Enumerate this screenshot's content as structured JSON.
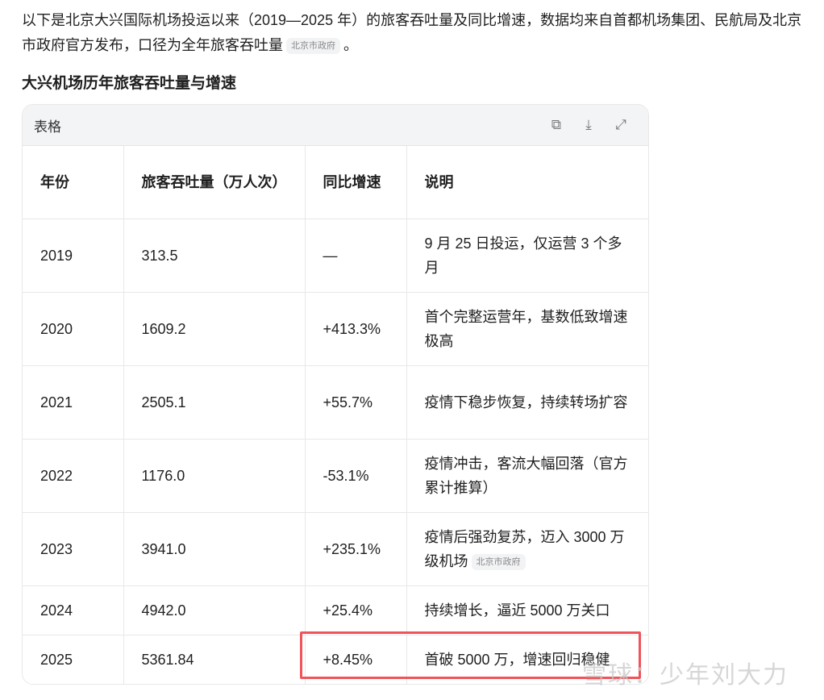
{
  "intro": {
    "text": "以下是北京大兴国际机场投运以来（2019—2025 年）的旅客吞吐量及同比增速，数据均来自首都机场集团、民航局及北京市政府官方发布，口径为全年旅客吞吐量",
    "source_badge": "北京市政府",
    "end": "。"
  },
  "heading": "大兴机场历年旅客吞吐量与增速",
  "table_card": {
    "title": "表格",
    "icons": [
      "copy-icon",
      "download-icon",
      "expand-icon"
    ]
  },
  "table": {
    "headers": [
      "年份",
      "旅客吞吐量（万人次）",
      "同比增速",
      "说明"
    ],
    "rows": [
      {
        "year": "2019",
        "volume": "313.5",
        "growth": "—",
        "note": "9 月 25 日投运，仅运营 3 个多月"
      },
      {
        "year": "2020",
        "volume": "1609.2",
        "growth": "+413.3%",
        "note": "首个完整运营年，基数低致增速极高"
      },
      {
        "year": "2021",
        "volume": "2505.1",
        "growth": "+55.7%",
        "note": "疫情下稳步恢复，持续转场扩容"
      },
      {
        "year": "2022",
        "volume": "1176.0",
        "growth": "-53.1%",
        "note": "疫情冲击，客流大幅回落（官方累计推算）"
      },
      {
        "year": "2023",
        "volume": "3941.0",
        "growth": "+235.1%",
        "note": "疫情后强劲复苏，迈入 3000 万级机场",
        "badge": "北京市政府"
      },
      {
        "year": "2024",
        "volume": "4942.0",
        "growth": "+25.4%",
        "note": "持续增长，逼近 5000 万关口"
      },
      {
        "year": "2025",
        "volume": "5361.84",
        "growth": "+8.45%",
        "note": "首破 5000 万，增速回归稳健"
      }
    ]
  },
  "watermark": "雪球：少年刘大力"
}
